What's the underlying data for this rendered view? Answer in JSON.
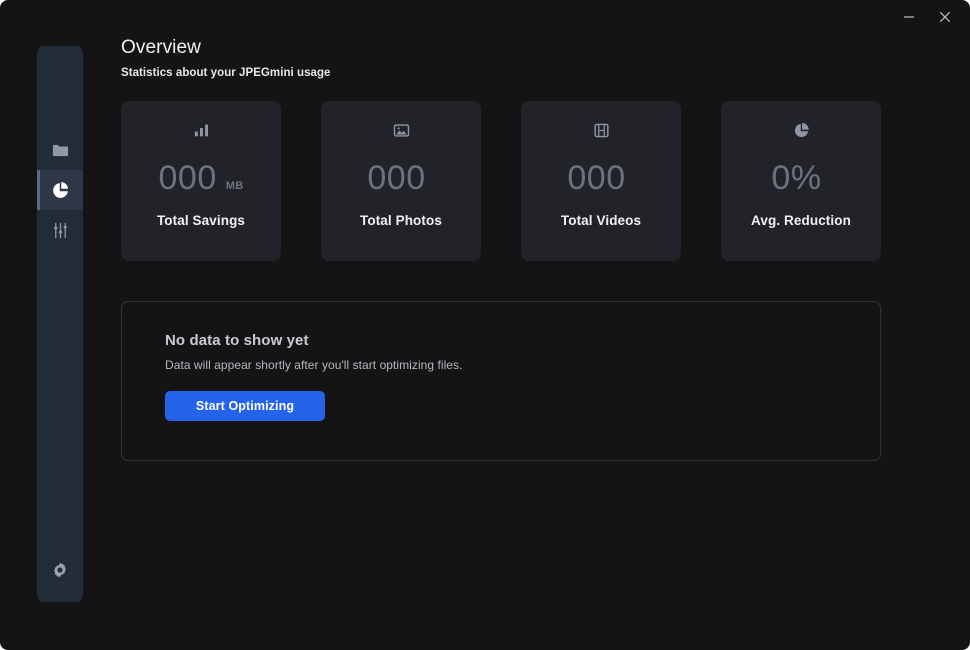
{
  "window": {
    "controls": [
      {
        "name": "minimize",
        "glyph": "minimize-icon"
      },
      {
        "name": "close",
        "glyph": "close-icon"
      }
    ]
  },
  "sidebar": {
    "items": [
      {
        "id": "files",
        "icon": "folder-icon",
        "active": false
      },
      {
        "id": "overview",
        "icon": "pie-chart-icon",
        "active": true
      },
      {
        "id": "adjustments",
        "icon": "sliders-icon",
        "active": false
      }
    ],
    "bottom_items": [
      {
        "id": "settings",
        "icon": "gear-icon",
        "active": false
      }
    ],
    "active_accent": "#5d6b80",
    "active_background": "#2d3748",
    "background": "#222b38"
  },
  "header": {
    "title": "Overview",
    "subtitle": "Statistics about your JPEGmini usage"
  },
  "stats": [
    {
      "icon": "bar-chart-icon",
      "value": "000",
      "unit": "MB",
      "label": "Total Savings"
    },
    {
      "icon": "image-icon",
      "value": "000",
      "unit": "",
      "label": "Total Photos"
    },
    {
      "icon": "film-icon",
      "value": "000",
      "unit": "",
      "label": "Total Videos"
    },
    {
      "icon": "pie-chart-icon",
      "value": "0%",
      "unit": "",
      "label": "Avg. Reduction"
    }
  ],
  "empty_state": {
    "title": "No data to show yet",
    "description": "Data will appear shortly after you'll start optimizing files.",
    "button_label": "Start Optimizing",
    "button_color": "#2563eb"
  },
  "colors": {
    "page_background": "#141414",
    "card_background": "#212329",
    "panel_border": "#2b3240",
    "muted_text": "#6d737e",
    "primary_text": "#f0f1f3"
  }
}
